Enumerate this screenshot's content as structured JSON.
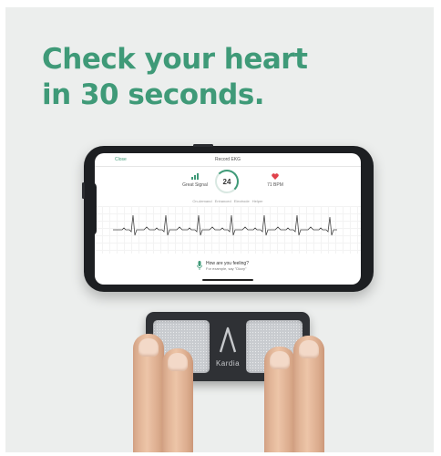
{
  "headline": {
    "line1": "Check your heart",
    "line2": "in 30 seconds."
  },
  "phone_screen": {
    "close_label": "Close",
    "title": "Record EKG",
    "signal_label": "Great Signal",
    "timer_value": "24",
    "heart_rate": "71 BPM",
    "filters_text": "On-demand  Enhanced  Electrode Helper",
    "prompt_title": "How are you feeling?",
    "prompt_subtitle": "For example, say \"Dizzy\""
  },
  "device": {
    "brand": "Kardia"
  },
  "colors": {
    "accent": "#3f9a78",
    "heart": "#e0424b"
  }
}
